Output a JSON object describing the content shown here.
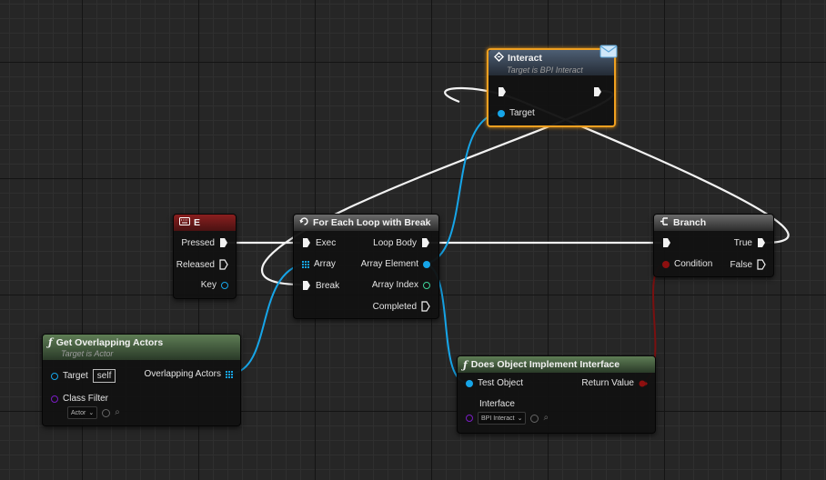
{
  "colors": {
    "exec_wire": "#f2f2f2",
    "object_wire": "#16a5e8",
    "bool_wire": "#7a1010",
    "selected_outline": "#f0a020"
  },
  "nodes": {
    "key_e": {
      "title": "E",
      "icon": "keyboard-icon",
      "pins": {
        "pressed": "Pressed",
        "released": "Released",
        "key": "Key"
      }
    },
    "for_each": {
      "title": "For Each Loop with Break",
      "icon": "loop-icon",
      "pins": {
        "exec": "Exec",
        "array": "Array",
        "break": "Break",
        "loop_body": "Loop Body",
        "array_element": "Array Element",
        "array_index": "Array Index",
        "completed": "Completed"
      }
    },
    "interact": {
      "title": "Interact",
      "subtitle": "Target is BPI Interact",
      "icon": "interface-message-icon",
      "pins": {
        "target": "Target"
      }
    },
    "branch": {
      "title": "Branch",
      "icon": "branch-icon",
      "pins": {
        "condition": "Condition",
        "true": "True",
        "false": "False"
      }
    },
    "get_overlapping": {
      "title": "Get Overlapping Actors",
      "subtitle": "Target is Actor",
      "icon": "function-icon",
      "pins": {
        "target": "Target",
        "target_value": "self",
        "class_filter": "Class Filter",
        "class_filter_value": "Actor",
        "overlapping_actors": "Overlapping Actors"
      }
    },
    "does_implement": {
      "title": "Does Object Implement Interface",
      "icon": "function-icon",
      "pins": {
        "test_object": "Test Object",
        "return_value": "Return Value",
        "interface": "Interface",
        "interface_value": "BPI Interact"
      }
    }
  }
}
